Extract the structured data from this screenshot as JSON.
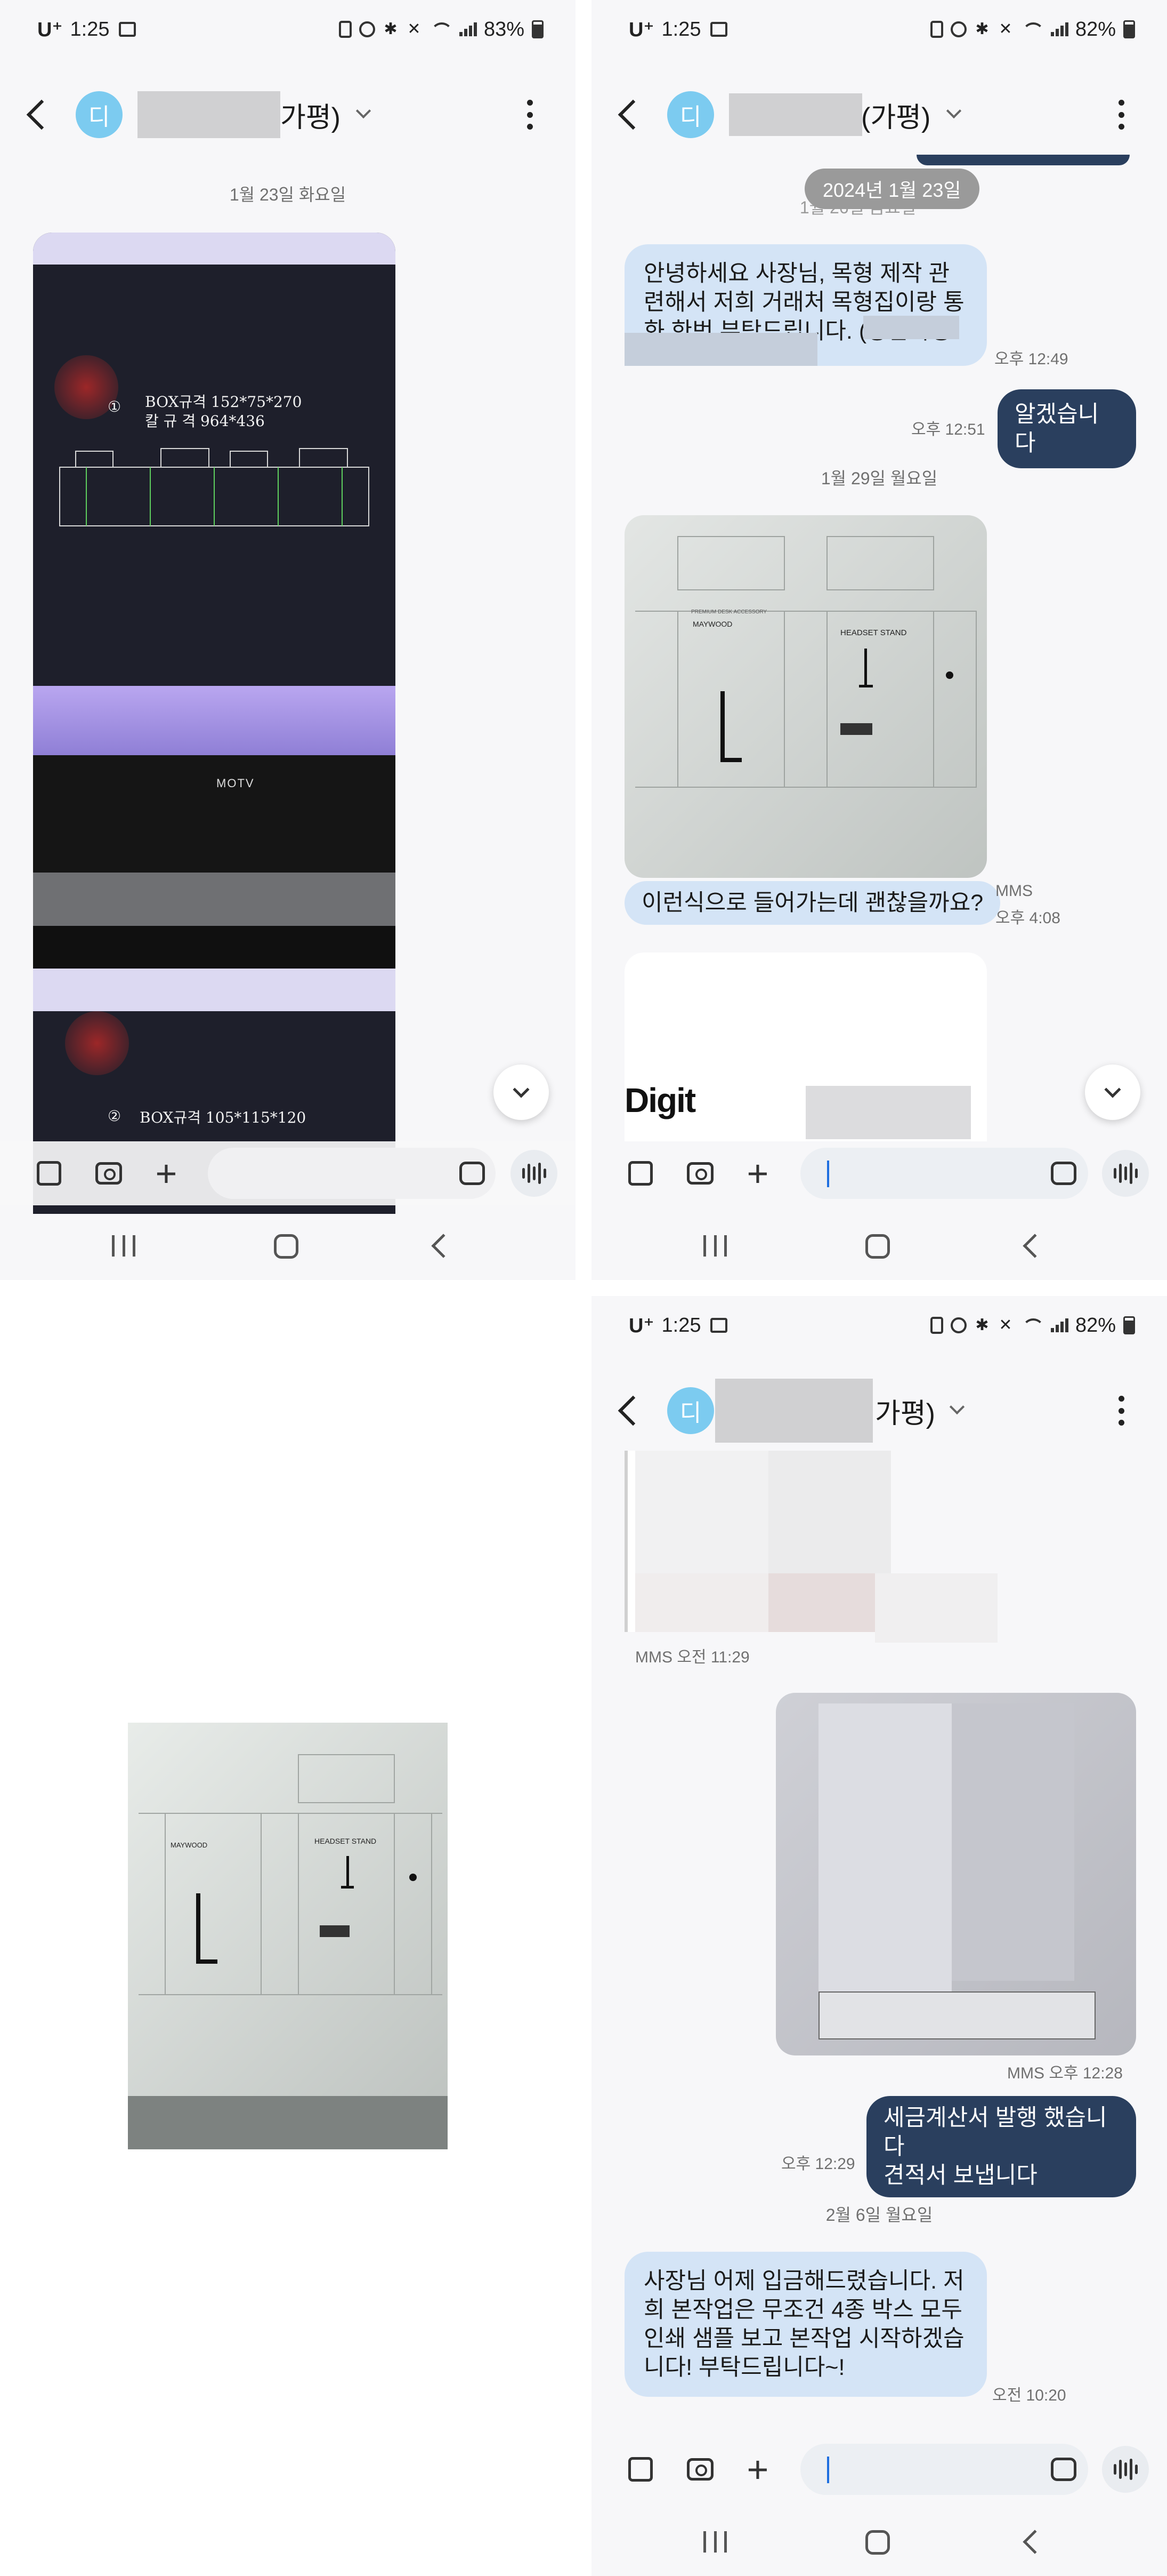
{
  "status_bar": {
    "carrier": "U⁺",
    "time": "1:25",
    "battery_panel1": "83%",
    "battery_panel2": "82%",
    "battery_panel4": "82%"
  },
  "header": {
    "avatar_initial": "디",
    "name_suffix": "가평)",
    "name_suffix_alt": "(가평)"
  },
  "panel1": {
    "date_separator": "1월 23일 화요일",
    "cad_text_1": "BOX규격 152*75*270",
    "cad_text_2": "칼 규 격 964*436",
    "cad_num_1": "①",
    "monitor_brand": "MOTV",
    "cad_text_3": "BOX규격 105*115*120",
    "cad_num_2": "②"
  },
  "panel2": {
    "date_pill": "2024년 1월 23일",
    "date_behind": "1월 26일 금요일",
    "msg_in_1": "안녕하세요 사장님, 목형 제작 관련해서 저희 거래처 목형집이랑 통화 한번 부탁드립니다. (상관목형:",
    "msg_in_1_time": "오후 12:49",
    "msg_out_1": "알겠습니다",
    "msg_out_1_time": "오후 12:51",
    "date_separator_2": "1월 29일 월요일",
    "photo_brand": "MAYWOOD",
    "photo_title": "HEADSET STAND",
    "photo_subtitle": "PREMIUM DESK ACCESSORY",
    "msg_in_2": "이런식으로 들어가는데 괜찮을까요?",
    "msg_in_2_type": "MMS",
    "msg_in_2_time": "오후 4:08",
    "logo_text": "Digit"
  },
  "panel3": {
    "photo_brand": "MAYWOOD",
    "photo_title": "HEADSET STAND"
  },
  "panel4": {
    "mms_time_1": "MMS 오전 11:29",
    "mms_time_2": "MMS 오후 12:28",
    "msg_out_2_line1": "세금계산서 발행 했습니다",
    "msg_out_2_line2": "견적서 보냅니다",
    "msg_out_2_time": "오후 12:29",
    "date_separator_3": "2월 6일 월요일",
    "msg_in_3": "사장님 어제 입금해드렸습니다. 저희 본작업은 무조건 4종 박스 모두 인쇄 샘플 보고 본작업 시작하겠습니다! 부탁드립니다~!",
    "msg_in_3_time": "오전 10:20"
  },
  "colors": {
    "incoming_bubble": "#d4e4f6",
    "outgoing_bubble": "#2a3f5e",
    "avatar": "#7ccbf0",
    "cursor": "#1e6fe0"
  }
}
